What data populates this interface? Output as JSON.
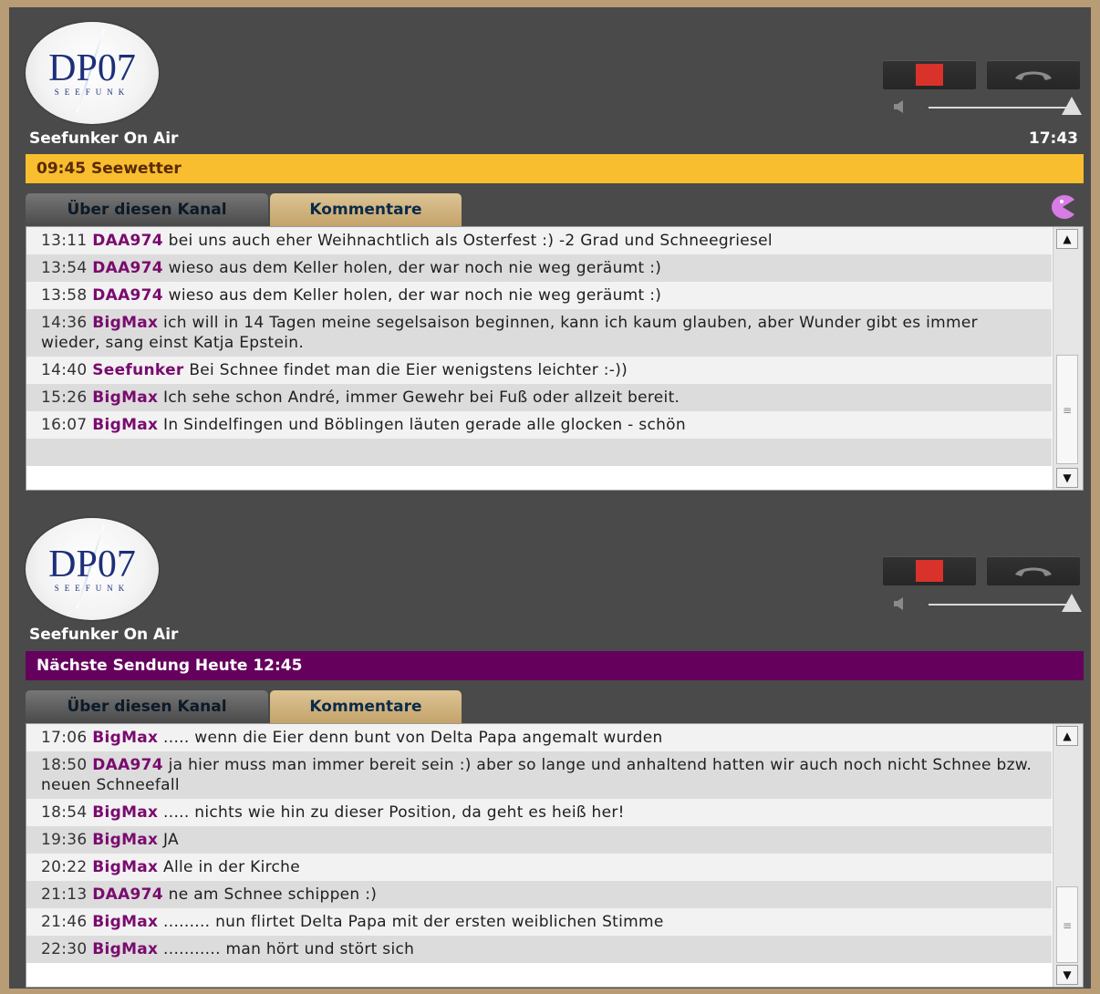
{
  "panel1": {
    "logo_text": "DP07",
    "logo_sub": "SEEFUNK",
    "title": "Seefunker On Air",
    "clock": "17:43",
    "bar": "09:45 Seewetter",
    "tabs": [
      "Über diesen Kanal",
      "Kommentare"
    ],
    "comments": [
      {
        "time": "13:11",
        "user": "DAA974",
        "text": "bei uns auch eher Weihnachtlich als Osterfest :) -2 Grad und Schneegriesel"
      },
      {
        "time": "13:54",
        "user": "DAA974",
        "text": "wieso aus dem Keller holen, der war noch nie weg geräumt :)"
      },
      {
        "time": "13:58",
        "user": "DAA974",
        "text": "wieso aus dem Keller holen, der war noch nie weg geräumt :)"
      },
      {
        "time": "14:36",
        "user": "BigMax",
        "text": "ich will in 14 Tagen meine segelsaison beginnen, kann ich kaum glauben, aber Wunder gibt es immer wieder, sang einst Katja Epstein."
      },
      {
        "time": "14:40",
        "user": "Seefunker",
        "text": "Bei Schnee findet man die Eier wenigstens leichter :-))"
      },
      {
        "time": "15:26",
        "user": "BigMax",
        "text": "Ich sehe schon André, immer Gewehr bei Fuß oder allzeit bereit."
      },
      {
        "time": "16:07",
        "user": "BigMax",
        "text": "In Sindelfingen und Böblingen läuten gerade alle glocken - schön"
      },
      {
        "time": "",
        "user": "",
        "text": ""
      }
    ]
  },
  "panel2": {
    "logo_text": "DP07",
    "logo_sub": "SEEFUNK",
    "title": "Seefunker On Air",
    "bar": "Nächste Sendung Heute 12:45",
    "tabs": [
      "Über diesen Kanal",
      "Kommentare"
    ],
    "comments": [
      {
        "time": "17:06",
        "user": "BigMax",
        "text": "..... wenn die Eier denn bunt von Delta Papa angemalt wurden"
      },
      {
        "time": "18:50",
        "user": "DAA974",
        "text": "ja hier muss man immer bereit sein :) aber so lange und anhaltend hatten wir auch noch nicht Schnee bzw. neuen Schneefall"
      },
      {
        "time": "18:54",
        "user": "BigMax",
        "text": "..... nichts wie hin zu dieser Position, da geht es heiß her!"
      },
      {
        "time": "19:36",
        "user": "BigMax",
        "text": "JA"
      },
      {
        "time": "20:22",
        "user": "BigMax",
        "text": "Alle in der Kirche"
      },
      {
        "time": "21:13",
        "user": "DAA974",
        "text": "ne am Schnee schippen :)"
      },
      {
        "time": "21:46",
        "user": "BigMax",
        "text": "......... nun flirtet Delta Papa mit der ersten weiblichen Stimme"
      },
      {
        "time": "22:30",
        "user": "BigMax",
        "text": "........... man hört und stört sich"
      }
    ]
  },
  "icons": {
    "stop": "stop-icon",
    "phone": "phone-icon",
    "volume": "speaker-icon",
    "pacman": "pacman-icon",
    "scroll_up": "▲",
    "scroll_down": "▼",
    "grip": "≡"
  },
  "colors": {
    "yellow_bar": "#f8be2f",
    "purple_bar": "#65005d",
    "username": "#7a0b6e",
    "stop_red": "#d9322b"
  }
}
